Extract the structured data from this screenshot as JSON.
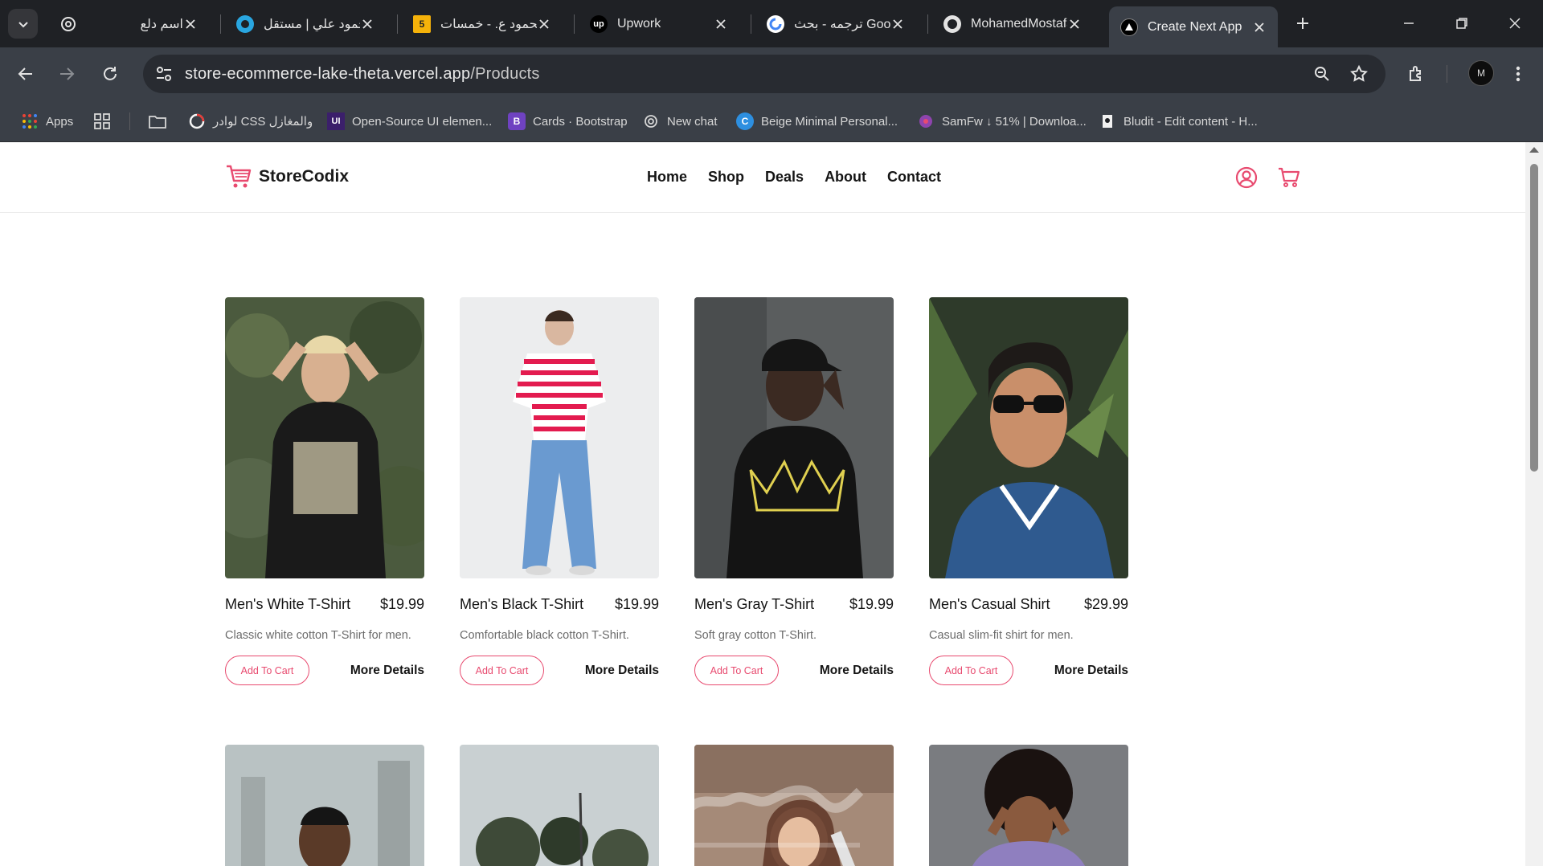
{
  "browser": {
    "tabs": [
      {
        "title": "اسم دلع",
        "favicon": "openai-icon"
      },
      {
        "title": "محمود علي | مستقل",
        "favicon": "mostaql-icon"
      },
      {
        "title": "محمود ع. - خمسات",
        "favicon": "khamsat-icon"
      },
      {
        "title": "Upwork",
        "favicon": "upwork-icon"
      },
      {
        "title": "ترجمه - بحث Google",
        "favicon": "google-icon"
      },
      {
        "title": "MohamedMostafa",
        "favicon": "github-icon"
      },
      {
        "title": "Create Next App",
        "favicon": "vercel-icon",
        "active": true
      }
    ],
    "url_host": "store-ecommerce-lake-theta.vercel.app",
    "url_path": "/Products",
    "avatar_text": "M",
    "bookmarks": [
      {
        "label": "Apps"
      },
      {
        "label": "لوادر CSS والمغازل"
      },
      {
        "label": "Open-Source UI elemen..."
      },
      {
        "label": "Cards · Bootstrap"
      },
      {
        "label": "New chat"
      },
      {
        "label": "Beige Minimal Personal..."
      },
      {
        "label": "SamFw ↓ 51% | Downloa..."
      },
      {
        "label": "Bludit - Edit content - H..."
      }
    ]
  },
  "site": {
    "brand": "StoreCodix",
    "accent": "#e84a6f",
    "nav": [
      "Home",
      "Shop",
      "Deals",
      "About",
      "Contact"
    ],
    "products": [
      {
        "name": "Men's White T-Shirt",
        "price": "$19.99",
        "desc": "Classic white cotton T-Shirt for men.",
        "cart": "Add To Cart",
        "more": "More Details"
      },
      {
        "name": "Men's Black T-Shirt",
        "price": "$19.99",
        "desc": "Comfortable black cotton T-Shirt.",
        "cart": "Add To Cart",
        "more": "More Details"
      },
      {
        "name": "Men's Gray T-Shirt",
        "price": "$19.99",
        "desc": "Soft gray cotton T-Shirt.",
        "cart": "Add To Cart",
        "more": "More Details"
      },
      {
        "name": "Men's Casual Shirt",
        "price": "$29.99",
        "desc": "Casual slim-fit shirt for men.",
        "cart": "Add To Cart",
        "more": "More Details"
      }
    ]
  }
}
